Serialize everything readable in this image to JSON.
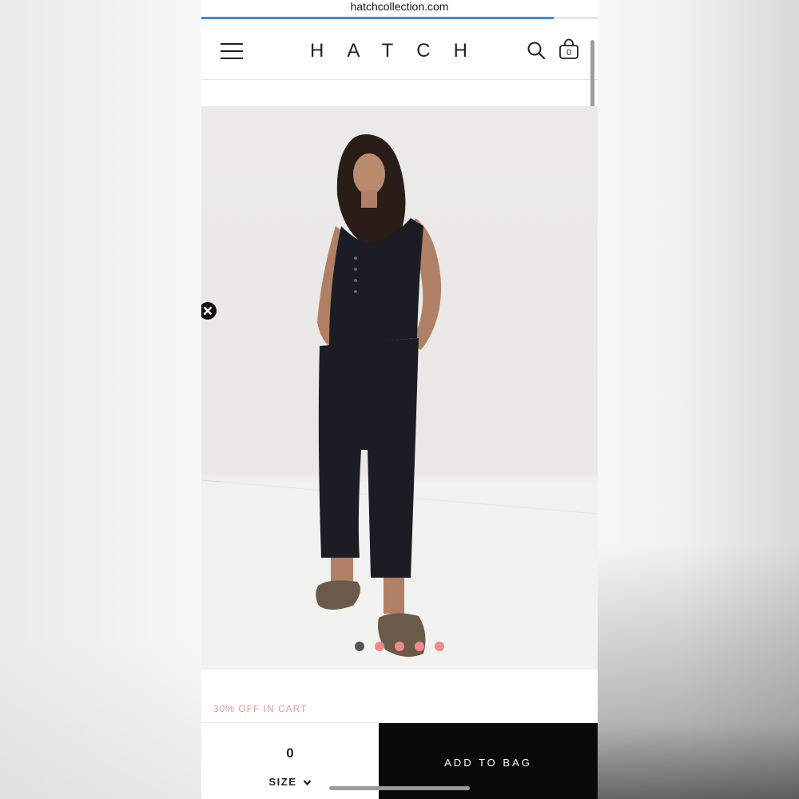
{
  "browser": {
    "url": "hatchcollection.com",
    "load_progress": 0.89
  },
  "header": {
    "menu_icon": "hamburger-menu-icon",
    "logo": "HATCH",
    "search_icon": "search-icon",
    "bag_icon": "shopping-bag-icon",
    "bag_count": "0"
  },
  "gallery": {
    "image_subject": "model wearing black sleeveless jumpsuit with sandals",
    "close_icon": "close-icon",
    "slide_count": 5,
    "active_slide": 1
  },
  "product": {
    "promo_text": "30% OFF IN CART"
  },
  "purchase_bar": {
    "quantity": "0",
    "size_label": "SIZE",
    "add_to_bag_label": "ADD TO BAG"
  },
  "colors": {
    "accent_blue": "#3b8be6",
    "promo_pink": "#e39a93",
    "dot_active": "#555555",
    "dot_inactive": "#f08a8a",
    "button_black": "#0a0a0a"
  }
}
